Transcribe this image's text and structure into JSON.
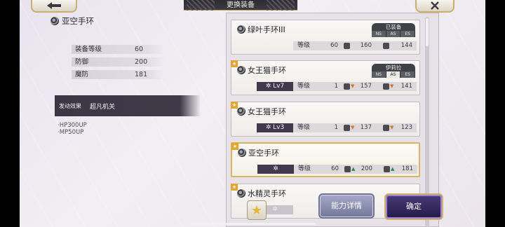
{
  "header": {
    "title": "更换装备"
  },
  "selected_equipment": {
    "name": "亚空手环",
    "stats": [
      {
        "label": "装备等级",
        "value": "60"
      },
      {
        "label": "防御",
        "value": "200"
      },
      {
        "label": "魔防",
        "value": "181"
      }
    ],
    "effect_label": "发动效果",
    "effect_value": "超凡机关",
    "bonuses": [
      "·HP300UP",
      "·MP50UP"
    ]
  },
  "list": [
    {
      "name": "绿叶手环III",
      "starred": false,
      "selected": false,
      "owner": {
        "status": "已装备",
        "skills": [
          "NS",
          "AS",
          "ES"
        ],
        "active_skill": ""
      },
      "level_label": "",
      "grade_label": "等级",
      "grade": "60",
      "def": "160",
      "def_trend": "",
      "mdef": "144",
      "mdef_trend": ""
    },
    {
      "name": "女王猫手环",
      "starred": true,
      "selected": false,
      "owner": {
        "status": "伊莉拉",
        "skills": [
          "NS",
          "AS",
          "ES"
        ],
        "active_skill": "AS"
      },
      "level_label": "✲ Lv7",
      "grade_label": "等级",
      "grade": "1",
      "def": "157",
      "def_trend": "down",
      "mdef": "141",
      "mdef_trend": "down"
    },
    {
      "name": "女王猫手环",
      "starred": true,
      "selected": false,
      "owner": null,
      "level_label": "✲ Lv3",
      "grade_label": "等级",
      "grade": "1",
      "def": "137",
      "def_trend": "down",
      "mdef": "123",
      "mdef_trend": "down"
    },
    {
      "name": "亚空手环",
      "starred": true,
      "selected": true,
      "owner": null,
      "level_label": "✲",
      "grade_label": "等级",
      "grade": "60",
      "def": "200",
      "def_trend": "up",
      "mdef": "181",
      "mdef_trend": "up"
    },
    {
      "name": "水精灵手环",
      "starred": true,
      "selected": false,
      "owner": null,
      "level_label": "✲",
      "grade_label": "",
      "grade": "",
      "def": "",
      "def_trend": "",
      "mdef": "",
      "mdef_trend": ""
    }
  ],
  "buttons": {
    "detail": "能力详情",
    "confirm": "确定",
    "favorite_icon": "star-icon"
  },
  "colors": {
    "up": "#2e8a4e",
    "down": "#d2762a",
    "accent_gold": "#dbb461",
    "confirm_bg": "#2f2457"
  }
}
